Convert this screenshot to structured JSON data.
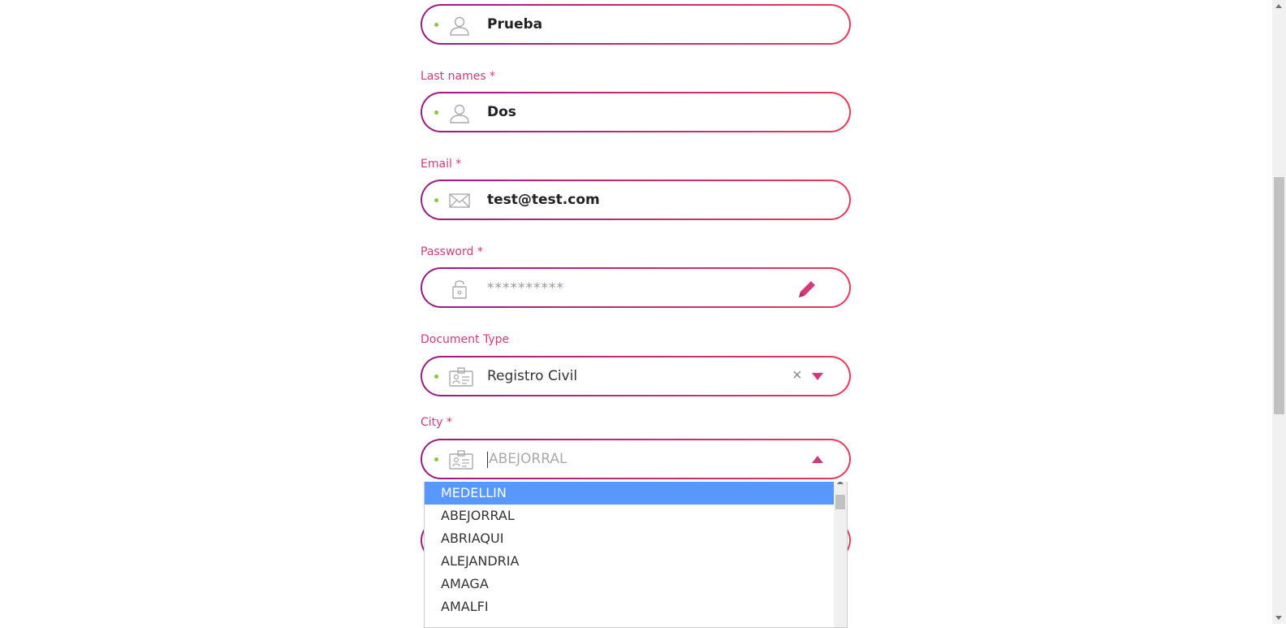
{
  "fields": {
    "first_name": {
      "value": "Prueba",
      "icon": "user-icon"
    },
    "last_name": {
      "label": "Last names *",
      "value": "Dos",
      "icon": "user-icon"
    },
    "email": {
      "label": "Email *",
      "value": "test@test.com",
      "icon": "envelope-icon"
    },
    "password": {
      "label": "Password *",
      "value": "**********",
      "icon": "lock-icon",
      "action_icon": "pencil-icon"
    },
    "document_type": {
      "label": "Document Type",
      "value": "Registro Civil",
      "icon": "id-card-icon",
      "clear": "×"
    },
    "city": {
      "label": "City *",
      "placeholder": "ABEJORRAL",
      "icon": "id-card-icon"
    }
  },
  "city_options": [
    "MEDELLIN",
    "ABEJORRAL",
    "ABRIAQUI",
    "ALEJANDRIA",
    "AMAGA",
    "AMALFI"
  ],
  "selected_option": "MEDELLIN",
  "colors": {
    "accent": "#d23a7c",
    "border_start": "#9b1b82",
    "border_end": "#e83a5a",
    "dot": "#8cc63f",
    "selected_bg": "#5897fb"
  }
}
